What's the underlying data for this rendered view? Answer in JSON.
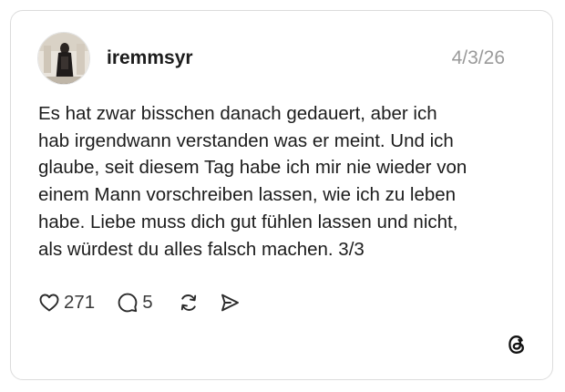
{
  "post": {
    "username": "iremmsyr",
    "date": "4/3/26",
    "text_lines": [
      "Es hat zwar bisschen danach gedauert, aber ich",
      "hab irgendwann verstanden was er meint. Und ich",
      "glaube, seit diesem Tag habe ich mir nie wieder von",
      "einem Mann vorschreiben lassen, wie ich zu leben",
      "habe. Liebe muss dich gut fühlen lassen und nicht,",
      "als würdest du alles falsch machen. 3/3"
    ]
  },
  "actions": {
    "likes": "271",
    "replies": "5"
  },
  "icons": {
    "like": "heart-icon",
    "reply": "comment-icon",
    "repost": "repost-icon",
    "share": "send-icon",
    "brand": "threads-logo-icon"
  },
  "colors": {
    "text": "#1c1c1c",
    "muted": "#9a9a9a",
    "border": "#dcdcdc"
  }
}
